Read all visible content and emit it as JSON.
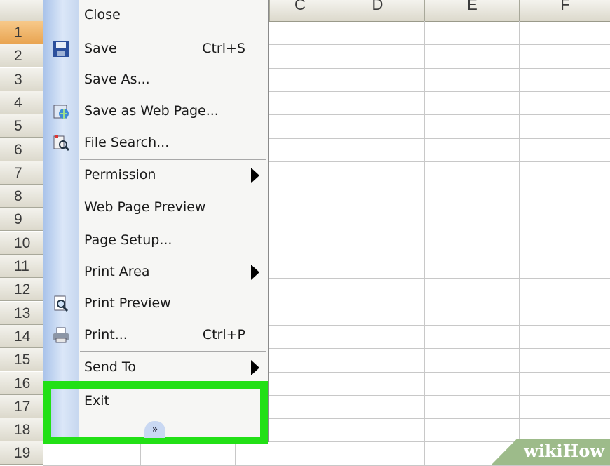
{
  "spreadsheet": {
    "columns": [
      "C",
      "D",
      "E",
      "F"
    ],
    "rows": [
      "1",
      "2",
      "3",
      "4",
      "5",
      "6",
      "7",
      "8",
      "9",
      "10",
      "11",
      "12",
      "13",
      "14",
      "15",
      "16",
      "17",
      "18",
      "19"
    ],
    "selected_row": "1",
    "selected_row_color": "#e9a552"
  },
  "file_menu": {
    "items": [
      {
        "label": "Close",
        "shortcut": "",
        "icon": "",
        "submenu": false
      },
      {
        "label": "Save",
        "shortcut": "Ctrl+S",
        "icon": "floppy-disk-icon",
        "submenu": false
      },
      {
        "label": "Save As...",
        "shortcut": "",
        "icon": "",
        "submenu": false
      },
      {
        "label": "Save as Web Page...",
        "shortcut": "",
        "icon": "web-page-icon",
        "submenu": false
      },
      {
        "label": "File Search...",
        "shortcut": "",
        "icon": "file-search-icon",
        "submenu": false
      },
      {
        "label": "Permission",
        "shortcut": "",
        "icon": "",
        "submenu": true
      },
      {
        "label": "Web Page Preview",
        "shortcut": "",
        "icon": "",
        "submenu": false
      },
      {
        "label": "Page Setup...",
        "shortcut": "",
        "icon": "",
        "submenu": false
      },
      {
        "label": "Print Area",
        "shortcut": "",
        "icon": "",
        "submenu": true
      },
      {
        "label": "Print Preview",
        "shortcut": "",
        "icon": "print-preview-icon",
        "submenu": false
      },
      {
        "label": "Print...",
        "shortcut": "Ctrl+P",
        "icon": "printer-icon",
        "submenu": false
      },
      {
        "label": "Send To",
        "shortcut": "",
        "icon": "",
        "submenu": true
      },
      {
        "label": "Exit",
        "shortcut": "",
        "icon": "",
        "submenu": false
      }
    ],
    "expand_glyph": "»",
    "highlight_color": "#22e016"
  },
  "watermark": {
    "text": "wikiHow"
  }
}
